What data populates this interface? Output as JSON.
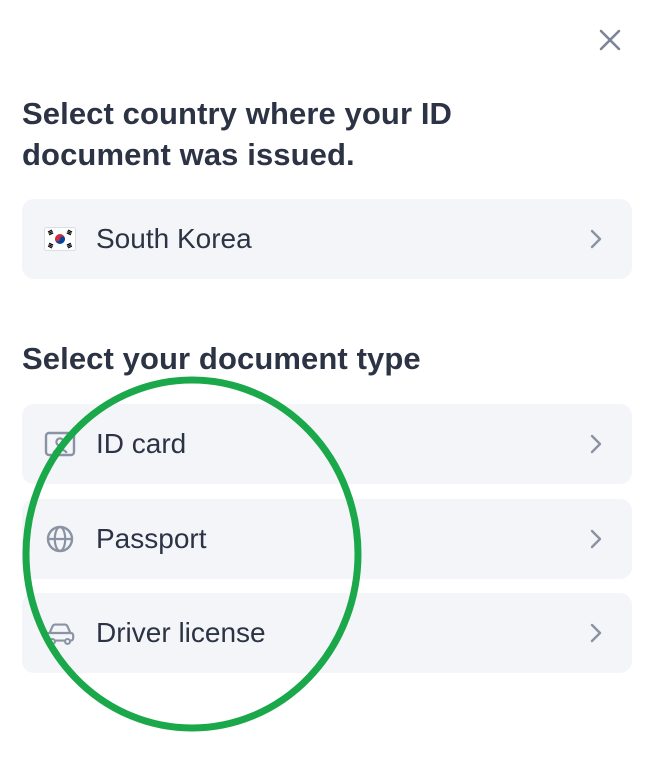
{
  "close": {
    "icon": "close-icon"
  },
  "country_section": {
    "heading": "Select country where your ID document was issued.",
    "selected_country": {
      "flag_icon": "south-korea-flag-icon",
      "label": "South Korea"
    }
  },
  "document_section": {
    "heading": "Select your document type",
    "options": [
      {
        "icon": "id-card-icon",
        "label": "ID card"
      },
      {
        "icon": "globe-icon",
        "label": "Passport"
      },
      {
        "icon": "car-icon",
        "label": "Driver license"
      }
    ]
  },
  "annotation": {
    "shape": "ellipse",
    "color": "#1aa84a"
  },
  "colors": {
    "text": "#2b3344",
    "row_background": "#f3f5f8",
    "icon_gray": "#8a93a3",
    "highlight": "#1aa84a"
  }
}
